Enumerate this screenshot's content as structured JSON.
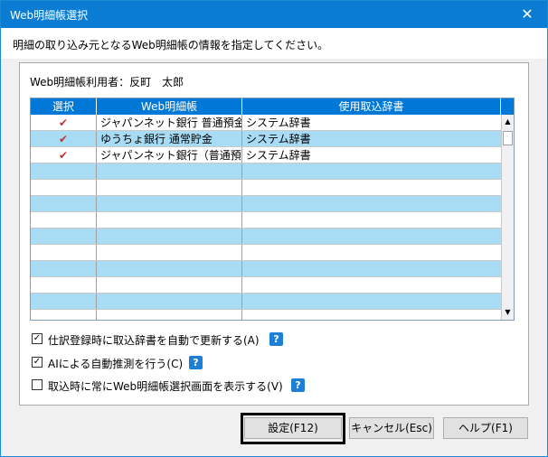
{
  "window": {
    "title": "Web明細帳選択",
    "close_label": "✕"
  },
  "instruction": "明細の取り込み元となるWeb明細帳の情報を指定してください。",
  "user_line": "Web明細帳利用者：反町　太郎",
  "grid": {
    "columns": [
      "選択",
      "Web明細帳",
      "使用取込辞書"
    ],
    "rows": [
      {
        "selected": "✔",
        "account": "ジャパンネット銀行 普通預金",
        "dictionary": "システム辞書"
      },
      {
        "selected": "✔",
        "account": "ゆうちょ銀行 通常貯金",
        "dictionary": "システム辞書"
      },
      {
        "selected": "✔",
        "account": "ジャパンネット銀行（普通預金：",
        "dictionary": "システム辞書"
      }
    ]
  },
  "options": [
    {
      "label": "仕訳登録時に取込辞書を自動で更新する(A)",
      "checked": true,
      "help": "?"
    },
    {
      "label": "AIによる自動推測を行う(C)",
      "checked": true,
      "help": "?"
    },
    {
      "label": "取込時に常にWeb明細帳選択画面を表示する(V)",
      "checked": false,
      "help": "?"
    }
  ],
  "buttons": {
    "ok": "設定(F12)",
    "cancel": "キャンセル(Esc)",
    "help": "ヘルプ(F1)"
  },
  "colors": {
    "titlebar": "#0a7cd4",
    "grid_header": "#0078d7",
    "row_alt": "#a8dcf5",
    "check": "#c8302c"
  }
}
